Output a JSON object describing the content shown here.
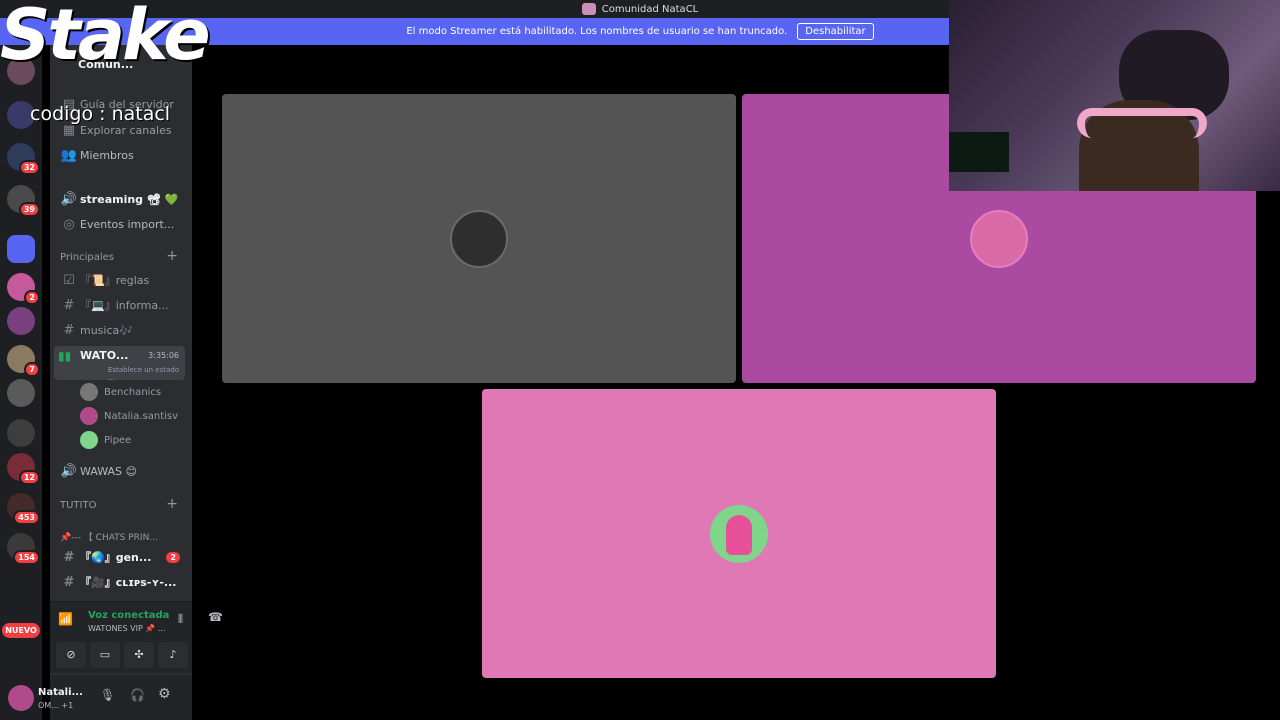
{
  "titlebar": {
    "title": "Comunidad NataCL"
  },
  "banner": {
    "message": "El modo Streamer está habilitado. Los nombres de usuario se han truncado.",
    "button_label": "Deshabilitar"
  },
  "guild_rail": {
    "badges": [
      "32",
      "39",
      "2",
      "7",
      "12",
      "453",
      "154"
    ],
    "new_label": "NUEVO"
  },
  "sidebar": {
    "server_name": "Comun...",
    "top_items": [
      {
        "label": "Guía del servidor",
        "icon": "guide-icon"
      },
      {
        "label": "Explorar canales",
        "icon": "browse-icon"
      },
      {
        "label": "Miembros",
        "icon": "members-icon"
      }
    ],
    "streaming_channel": "streaming 📽 💚",
    "events_channel": "Eventos import...",
    "category_principales": "Principales",
    "channels": [
      {
        "label": "『📜』reglas",
        "icon": "rules-icon"
      },
      {
        "label": "『💻』informa...",
        "icon": "hash-icon"
      },
      {
        "label": "musica🎶",
        "icon": "hash-icon"
      }
    ],
    "active_voice": {
      "name": "WATO...",
      "timer": "3:35:06",
      "status": "Establece un estado ..."
    },
    "voice_users": [
      "Benchanics",
      "Natalia.santisv",
      "Pipee"
    ],
    "wawas_channel": "WAWAS 😊",
    "category_tutito": "TUTITO",
    "pinned_category": "📌--- 【 CHATS PRIN...",
    "more_channels": [
      {
        "label": "『🌏』gen...",
        "badge": "2"
      },
      {
        "label": "『🎥』ᴄʟɪᴘs-ʏ-..."
      }
    ]
  },
  "voice_panel": {
    "status": "Voz conectada",
    "channel": "WATONES VIP 📌 ..."
  },
  "user_panel": {
    "name": "Natali...",
    "status": "OM... +1"
  },
  "overlay": {
    "logo": "Stake",
    "code": "codigo : natacl"
  },
  "colors": {
    "banner": "#5865f2",
    "tile_gray": "#545454",
    "tile_magenta": "#aa4ba1",
    "tile_pink": "#df78b5",
    "voice_green": "#23a55a"
  }
}
